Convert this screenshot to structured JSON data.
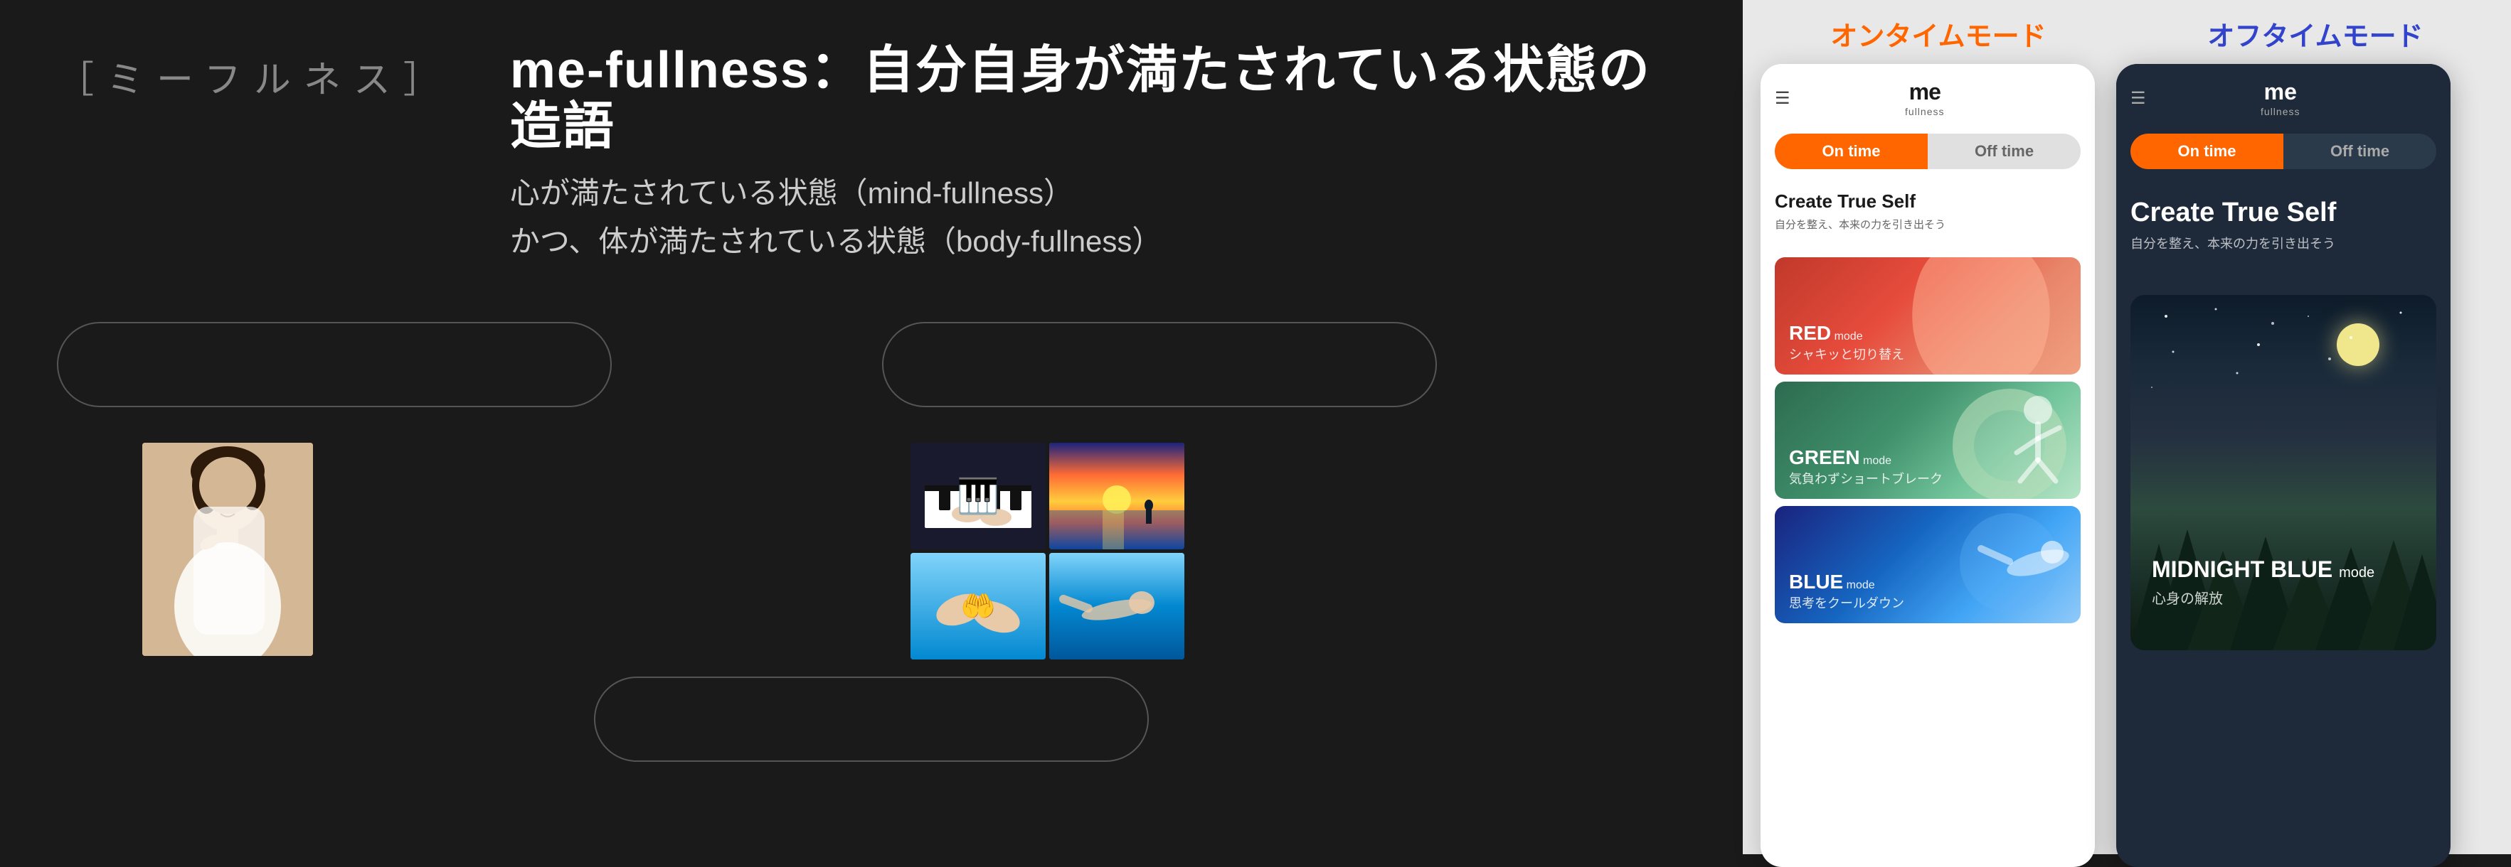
{
  "brand": {
    "bracket_left": "［ミーフルネス］",
    "title": "me-fullness：自分自身が満たされている状態の造語",
    "subtitle_line1": "心が満たされている状態（mind-fullness）",
    "subtitle_line2": "かつ、体が満たされている状態（body-fullness）"
  },
  "left_box": {
    "placeholder": ""
  },
  "right_box": {
    "placeholder": ""
  },
  "bottom_box": {
    "placeholder": ""
  },
  "ontime": {
    "label": "オンタイムモード",
    "toggle_on": "On time",
    "toggle_off": "Off time",
    "hero_title": "Create True Self",
    "hero_sub": "自分を整え、本来の力を引き出そう",
    "modes": [
      {
        "name": "RED",
        "name_suffix": "mode",
        "desc": "シャキッと切り替え",
        "color_class": "mode-card-red"
      },
      {
        "name": "GREEN",
        "name_suffix": "mode",
        "desc": "気負わずショートブレーク",
        "color_class": "mode-card-green"
      },
      {
        "name": "BLUE",
        "name_suffix": "mode",
        "desc": "思考をクールダウン",
        "color_class": "mode-card-blue"
      }
    ],
    "logo_me": "me",
    "logo_fullness": "fullness"
  },
  "offtime": {
    "label": "オフタイムモード",
    "toggle_on": "On time",
    "toggle_off": "Off time",
    "hero_title": "Create True Self",
    "hero_sub": "自分を整え、本来の力を引き出そう",
    "midnight_mode_name": "MIDNIGHT BLUE",
    "midnight_mode_suffix": "mode",
    "midnight_mode_desc": "心身の解放",
    "logo_me": "me",
    "logo_fullness": "fullness"
  }
}
